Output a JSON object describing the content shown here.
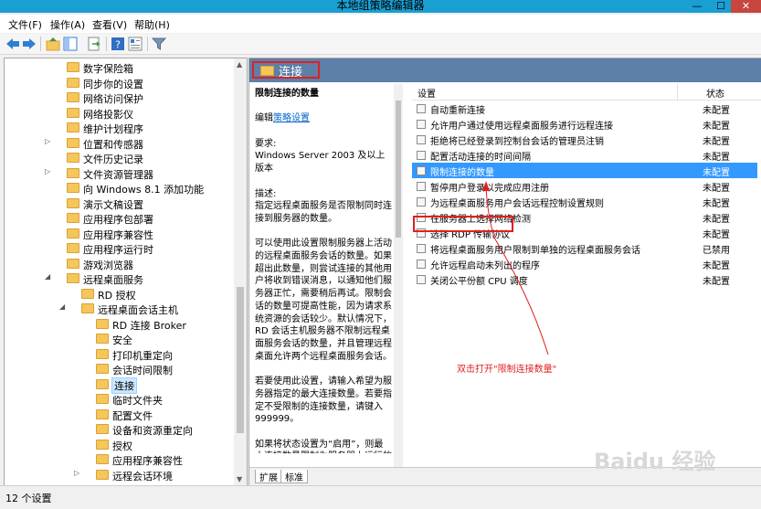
{
  "window": {
    "title": "本地组策略编辑器",
    "min": "—",
    "max": "☐",
    "close": "✕"
  },
  "menu": [
    "文件(F)",
    "操作(A)",
    "查看(V)",
    "帮助(H)"
  ],
  "toolbar_icons": [
    "back-icon",
    "forward-icon",
    "up-folder-icon",
    "show-tree-icon",
    "export-icon",
    "help-icon",
    "properties-icon",
    "filter-icon"
  ],
  "tree": [
    {
      "label": "数字保险箱",
      "expander": ""
    },
    {
      "label": "同步你的设置",
      "expander": ""
    },
    {
      "label": "网络访问保护",
      "expander": ""
    },
    {
      "label": "网络投影仪",
      "expander": ""
    },
    {
      "label": "维护计划程序",
      "expander": ""
    },
    {
      "label": "位置和传感器",
      "expander": "▷"
    },
    {
      "label": "文件历史记录",
      "expander": ""
    },
    {
      "label": "文件资源管理器",
      "expander": "▷"
    },
    {
      "label": "向 Windows 8.1 添加功能",
      "expander": ""
    },
    {
      "label": "演示文稿设置",
      "expander": ""
    },
    {
      "label": "应用程序包部署",
      "expander": ""
    },
    {
      "label": "应用程序兼容性",
      "expander": ""
    },
    {
      "label": "应用程序运行时",
      "expander": ""
    },
    {
      "label": "游戏浏览器",
      "expander": ""
    },
    {
      "label": "远程桌面服务",
      "expander": "◢"
    },
    {
      "label": "RD 授权",
      "expander": ""
    },
    {
      "label": "远程桌面会话主机",
      "expander": "◢"
    },
    {
      "label": "RD 连接 Broker",
      "expander": ""
    },
    {
      "label": "安全",
      "expander": ""
    },
    {
      "label": "打印机重定向",
      "expander": ""
    },
    {
      "label": "会话时间限制",
      "expander": ""
    },
    {
      "label": "连接",
      "expander": ""
    },
    {
      "label": "临时文件夹",
      "expander": ""
    },
    {
      "label": "配置文件",
      "expander": ""
    },
    {
      "label": "设备和资源重定向",
      "expander": ""
    },
    {
      "label": "授权",
      "expander": ""
    },
    {
      "label": "应用程序兼容性",
      "expander": ""
    },
    {
      "label": "远程会话环境",
      "expander": "▷"
    }
  ],
  "right": {
    "header_title": "连接",
    "desc_title": "限制连接的数量",
    "edit_prefix": "编辑",
    "edit_link": "策略设置",
    "req_label": "要求:",
    "req_text": "Windows Server 2003 及以上版本",
    "desc_label": "描述:",
    "p1": "指定远程桌面服务是否限制同时连接到服务器的数量。",
    "p2": "可以使用此设置限制服务器上活动的远程桌面服务会话的数量。如果超出此数量，则尝试连接的其他用户将收到错误消息，以通知他们服务器正忙，需要稍后再试。限制会话的数量可提高性能，因为请求系统资源的会话较少。默认情况下，RD 会话主机服务器不限制远程桌面服务会话的数量，并且管理远程桌面允许两个远程桌面服务会话。",
    "p3": "若要使用此设置，请输入希望为服务器指定的最大连接数量。若要指定不受限制的连接数量，请键入 999999。",
    "p4": "如果将状态设置为“启用”，则最大连接数量限制为服务器上运行的",
    "col_setting": "设置",
    "col_state": "状态",
    "rows": [
      {
        "name": "自动重新连接",
        "state": "未配置"
      },
      {
        "name": "允许用户通过使用远程桌面服务进行远程连接",
        "state": "未配置"
      },
      {
        "name": "拒绝将已经登录到控制台会话的管理员注销",
        "state": "未配置"
      },
      {
        "name": "配置活动连接的时间间隔",
        "state": "未配置"
      },
      {
        "name": "限制连接的数量",
        "state": "未配置"
      },
      {
        "name": "暂停用户登录以完成应用注册",
        "state": "未配置"
      },
      {
        "name": "为远程桌面服务用户会话远程控制设置规则",
        "state": "未配置"
      },
      {
        "name": "在服务器上选择网络检测",
        "state": "未配置"
      },
      {
        "name": "选择 RDP 传输协议",
        "state": "未配置"
      },
      {
        "name": "将远程桌面服务用户限制到单独的远程桌面服务会话",
        "state": "已禁用"
      },
      {
        "name": "允许远程启动未列出的程序",
        "state": "未配置"
      },
      {
        "name": "关闭公平份额 CPU 调度",
        "state": "未配置"
      }
    ],
    "tab_extended": "扩展",
    "tab_standard": "标准"
  },
  "status": "12 个设置",
  "annotation": "双击打开\"限制连接数量\"",
  "watermark": "Baidu 经验",
  "colors": {
    "title_bar": "#1a9fd3",
    "header": "#5d7fa8",
    "selection": "#3399ff",
    "annotation": "#e02020"
  }
}
